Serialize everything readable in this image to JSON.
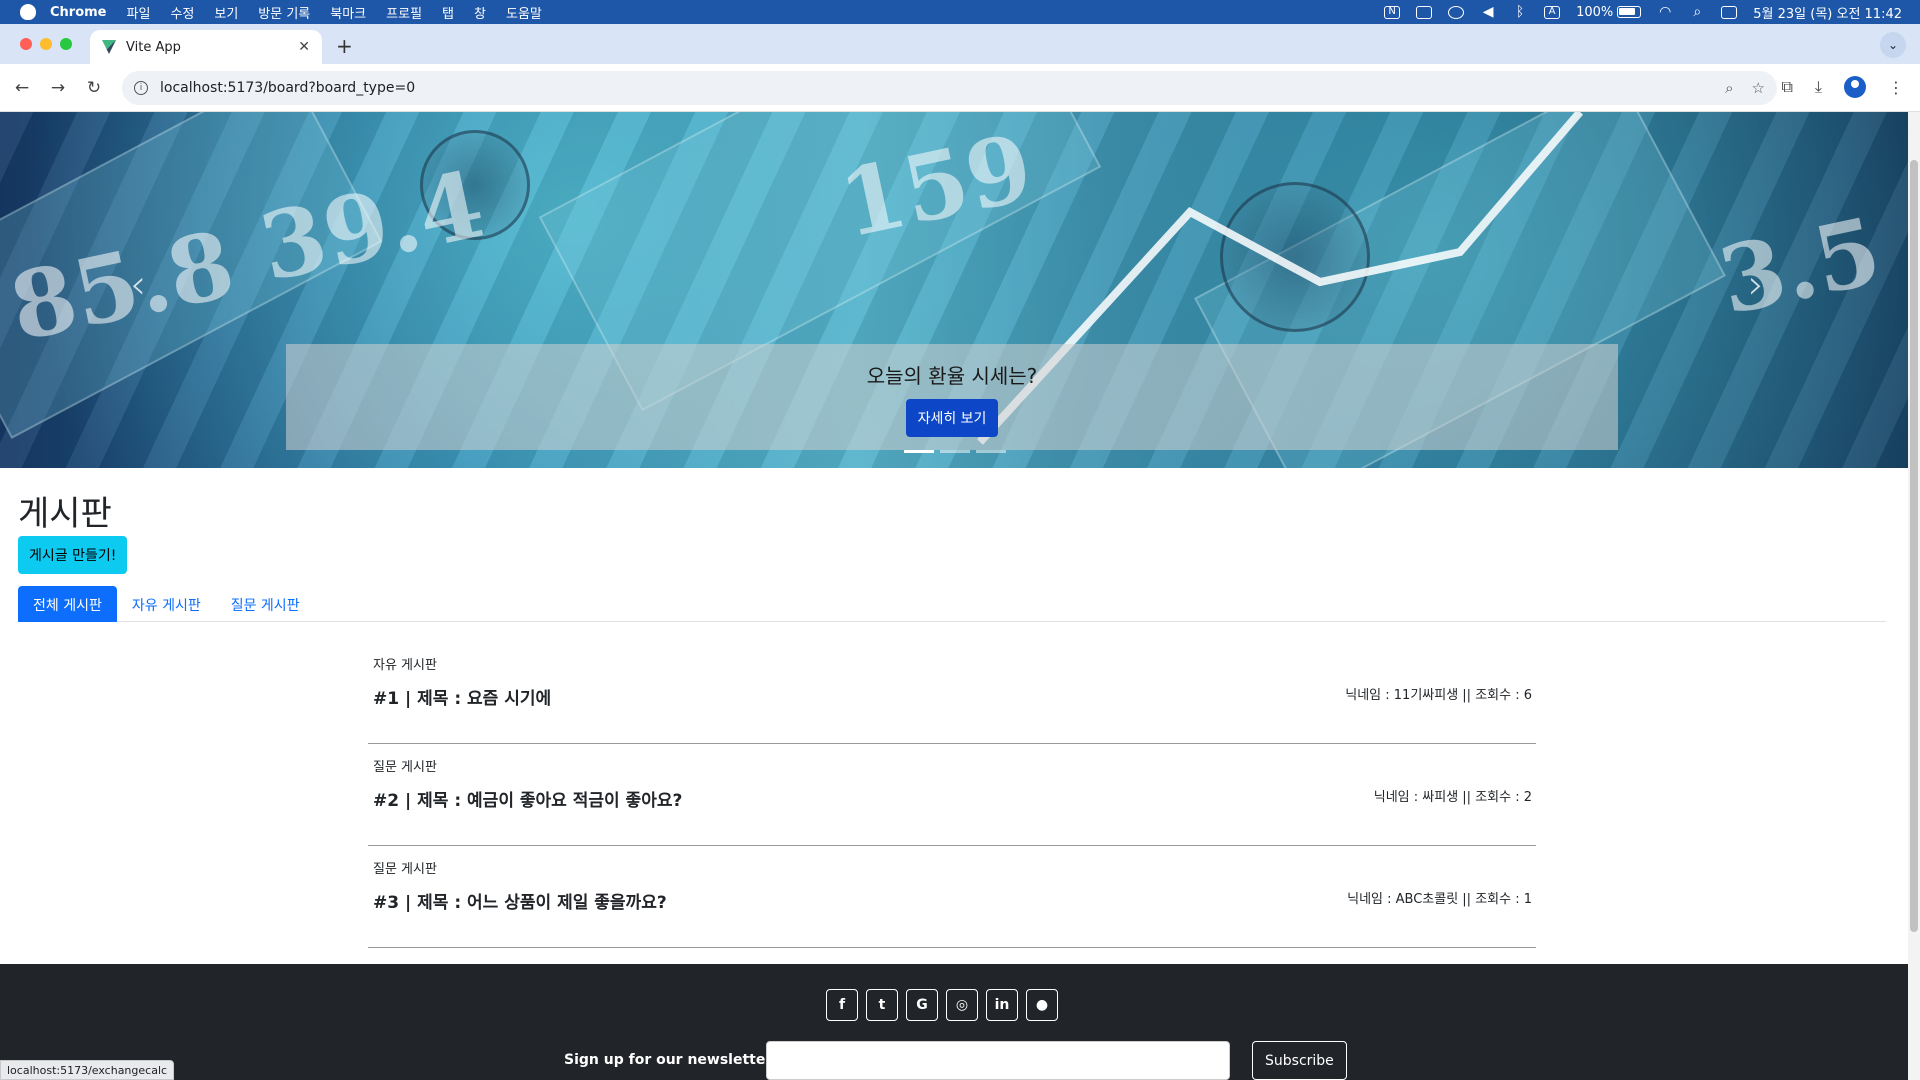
{
  "menubar": {
    "app": "Chrome",
    "items": [
      "파일",
      "수정",
      "보기",
      "방문 기록",
      "북마크",
      "프로필",
      "탭",
      "창",
      "도움말"
    ],
    "battery": "100%",
    "datetime": "5월 23일 (목) 오전 11:42"
  },
  "browser": {
    "tab_title": "Vite App",
    "url": "localhost:5173/board?board_type=0",
    "status_url": "localhost:5173/exchangecalc"
  },
  "hero": {
    "caption": "오늘의 환율 시세는?",
    "button": "자세히 보기"
  },
  "board": {
    "title": "게시판",
    "create_button": "게시글 만들기!",
    "tabs": [
      "전체 게시판",
      "자유 게시판",
      "질문 게시판"
    ],
    "active_tab": 0,
    "posts": [
      {
        "category": "자유 게시판",
        "title": "#1 | 제목 : 요즘 시기에",
        "meta": "닉네임 : 11기싸피생 || 조회수 : 6"
      },
      {
        "category": "질문 게시판",
        "title": "#2 | 제목 : 예금이 좋아요 적금이 좋아요?",
        "meta": "닉네임 : 싸피생 || 조회수 : 2"
      },
      {
        "category": "질문 게시판",
        "title": "#3 | 제목 : 어느 상품이 제일 좋을까요?",
        "meta": "닉네임 : ABC초콜릿 || 조회수 : 1"
      }
    ]
  },
  "footer": {
    "social_icons": [
      "facebook-icon",
      "twitter-icon",
      "google-icon",
      "instagram-icon",
      "linkedin-icon",
      "github-icon"
    ],
    "newsletter_label": "Sign up for our newsletter",
    "subscribe_button": "Subscribe"
  },
  "colors": {
    "menubar": "#1f57a8",
    "primary": "#0d6efd",
    "info": "#0dcaf0",
    "footer": "#212529"
  }
}
